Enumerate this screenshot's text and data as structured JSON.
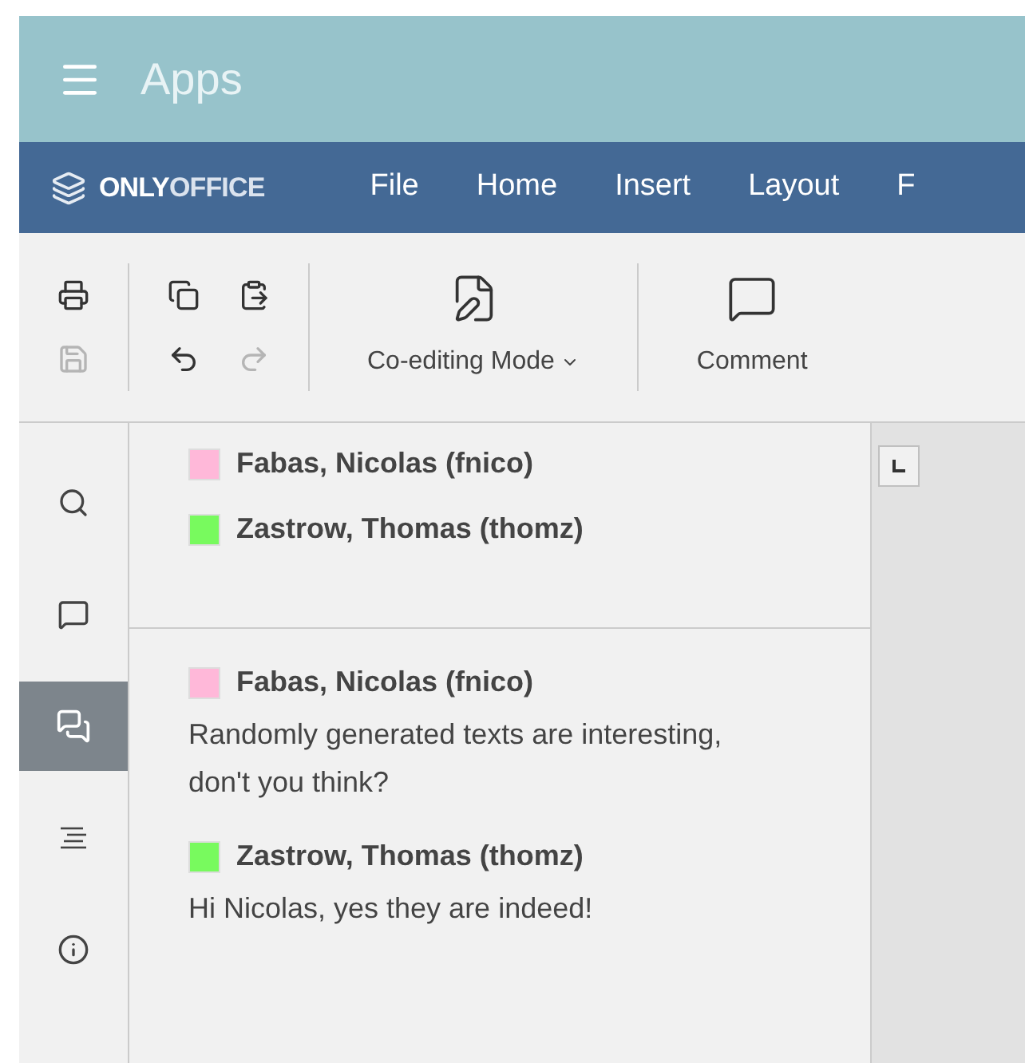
{
  "header": {
    "title": "Apps"
  },
  "menu": {
    "logo": {
      "bold": "ONLY",
      "light": "OFFICE"
    },
    "tabs": [
      {
        "label": "File",
        "selected": false
      },
      {
        "label": "Home",
        "selected": false
      },
      {
        "label": "Insert",
        "selected": false
      },
      {
        "label": "Layout",
        "selected": false
      },
      {
        "label": "F",
        "selected": false
      }
    ]
  },
  "toolbar": {
    "groups": [
      {
        "buttons": [
          {
            "kind": "print",
            "disabled": false
          },
          {
            "kind": "save",
            "disabled": true
          }
        ]
      },
      {
        "buttons": [
          {
            "kind": "copy",
            "disabled": false
          },
          {
            "kind": "paste",
            "disabled": false
          },
          {
            "kind": "undo",
            "disabled": false
          },
          {
            "kind": "redo",
            "disabled": true
          }
        ]
      },
      {
        "big": {
          "kind": "coedit",
          "label": "Co-editing Mode",
          "dropdown": true
        }
      },
      {
        "big": {
          "kind": "comment",
          "label": "Comment",
          "dropdown": false
        }
      }
    ]
  },
  "sidebar": {
    "items": [
      {
        "kind": "search",
        "selected": false
      },
      {
        "kind": "comments",
        "selected": false
      },
      {
        "kind": "chat",
        "selected": true
      },
      {
        "kind": "navigation",
        "selected": false
      },
      {
        "kind": "about",
        "selected": false
      }
    ]
  },
  "users": [
    {
      "name": "Fabas, Nicolas (fnico)",
      "color": "#ffb8d9"
    },
    {
      "name": "Zastrow, Thomas (thomz)",
      "color": "#78fa5e"
    }
  ],
  "messages": [
    {
      "author": "Fabas, Nicolas (fnico)",
      "color": "#ffb8d9",
      "text": "Randomly generated texts are interesting, don't you think?"
    },
    {
      "author": "Zastrow, Thomas (thomz)",
      "color": "#78fa5e",
      "text": "Hi Nicolas, yes they are indeed!"
    }
  ]
}
